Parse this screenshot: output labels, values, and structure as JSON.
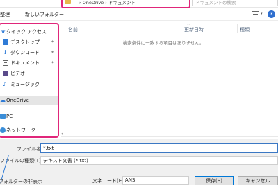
{
  "address_bar": {
    "breadcrumb": "› OneDrive › ドキュメント",
    "search_placeholder": "ドキュメントの検索"
  },
  "toolbar": {
    "organize_label": "整理",
    "new_folder_label": "新しいフォルダー"
  },
  "nav": {
    "items": [
      {
        "label": "クイック アクセス",
        "icon": "star-icon",
        "pinned": false
      },
      {
        "label": "デスクトップ",
        "icon": "desktop-icon",
        "pinned": true
      },
      {
        "label": "ダウンロード",
        "icon": "download-icon",
        "pinned": true
      },
      {
        "label": "ドキュメント",
        "icon": "document-icon",
        "pinned": true
      },
      {
        "label": "ビデオ",
        "icon": "video-icon",
        "pinned": false
      },
      {
        "label": "ミュージック",
        "icon": "music-icon",
        "pinned": false
      },
      {
        "label": "OneDrive",
        "icon": "cloud-icon",
        "pinned": false
      },
      {
        "label": "PC",
        "icon": "pc-icon",
        "pinned": false
      },
      {
        "label": "ネットワーク",
        "icon": "network-icon",
        "pinned": false
      }
    ],
    "pin_glyph": "📌"
  },
  "file_list": {
    "columns": [
      "名前",
      "更新日時",
      "種類"
    ],
    "empty_message": "検索条件に一致する項目はありません。"
  },
  "form": {
    "filename_label": "ファイル名(N):",
    "filename_value": "*.txt",
    "filetype_label": "ファイルの種類(T):",
    "filetype_value": "テキスト文書 (*.txt)",
    "hide_folders_label": "フォルダーの非表示",
    "encoding_label": "文字コード(E):",
    "encoding_value": "ANSI",
    "save_label": "保存(S)",
    "cancel_label": "キャンセル"
  },
  "colors": {
    "highlight": "#e0267a",
    "accent": "#2f7bd6"
  }
}
